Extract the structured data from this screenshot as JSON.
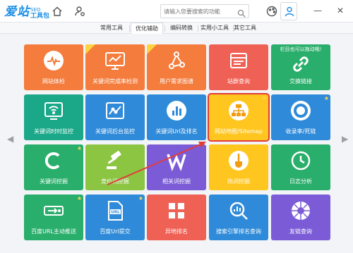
{
  "app": {
    "logo_main": "爱站",
    "logo_seo": "SEO",
    "logo_sub": "工具包"
  },
  "header": {
    "search_placeholder": "请输入您要搜索的功能",
    "icons": [
      "home-icon",
      "user-settings-icon",
      "search-icon",
      "skin-icon",
      "user-icon",
      "minimize-icon",
      "close-icon"
    ],
    "win_minimize": "—",
    "win_close": "✕"
  },
  "tabs": [
    {
      "label": "常用工具",
      "active": false
    },
    {
      "label": "优化辅助",
      "active": true
    },
    {
      "label": "编码转换",
      "active": false
    },
    {
      "label": "实用小工具",
      "active": false
    },
    {
      "label": "其它工具",
      "active": false
    }
  ],
  "nav": {
    "prev": "◀",
    "next": "▶"
  },
  "tiles": [
    {
      "label": "网站体检",
      "color": "#f47c3c",
      "icon": "heart-monitor-icon"
    },
    {
      "label": "关键词完成率检测",
      "color": "#f47c3c",
      "icon": "monitor-chart-icon",
      "badge": "NEW"
    },
    {
      "label": "用户需求图谱",
      "color": "#f47c3c",
      "icon": "network-graph-icon",
      "badge": "NEW"
    },
    {
      "label": "站群查询",
      "color": "#f06155",
      "icon": "site-stack-icon"
    },
    {
      "label": "交换链接",
      "color": "#2aae6b",
      "icon": "chain-link-icon",
      "note": "栏目也可以拖动哦!"
    },
    {
      "label": "关键词时时监控",
      "color": "#1aa889",
      "icon": "wifi-screen-icon"
    },
    {
      "label": "关键词后台监控",
      "color": "#2f8bd9",
      "icon": "trend-chart-icon"
    },
    {
      "label": "关键词Url及排名",
      "color": "#2f8bd9",
      "icon": "bar-chart-icon"
    },
    {
      "label": "网站地图/Sitemap",
      "color": "#ffc61f",
      "icon": "sitemap-icon",
      "star": true,
      "selected": true
    },
    {
      "label": "收录率/死链",
      "color": "#2f8bd9",
      "icon": "ring-icon",
      "star": true
    },
    {
      "label": "关键词挖掘",
      "color": "#2aae6b",
      "icon": "letter-c-icon",
      "star": true
    },
    {
      "label": "竞价词挖掘",
      "color": "#8cc542",
      "icon": "gavel-icon"
    },
    {
      "label": "相关词挖掘",
      "color": "#7b5cd6",
      "icon": "letter-w-icon"
    },
    {
      "label": "热词挖掘",
      "color": "#ffc61f",
      "icon": "shovel-icon"
    },
    {
      "label": "日志分析",
      "color": "#2aae6b",
      "icon": "clock-icon"
    },
    {
      "label": "百度URL主动推送",
      "color": "#2aae6b",
      "icon": "url-push-icon",
      "star": true
    },
    {
      "label": "百度Url提交",
      "color": "#2f8bd9",
      "icon": "url-doc-icon",
      "star": true
    },
    {
      "label": "异地排名",
      "color": "#f06155",
      "icon": "grid-icon"
    },
    {
      "label": "搜索引擎排名查询",
      "color": "#2f8bd9",
      "icon": "search-chart-icon"
    },
    {
      "label": "友链查询",
      "color": "#7b5cd6",
      "icon": "aperture-icon"
    }
  ]
}
